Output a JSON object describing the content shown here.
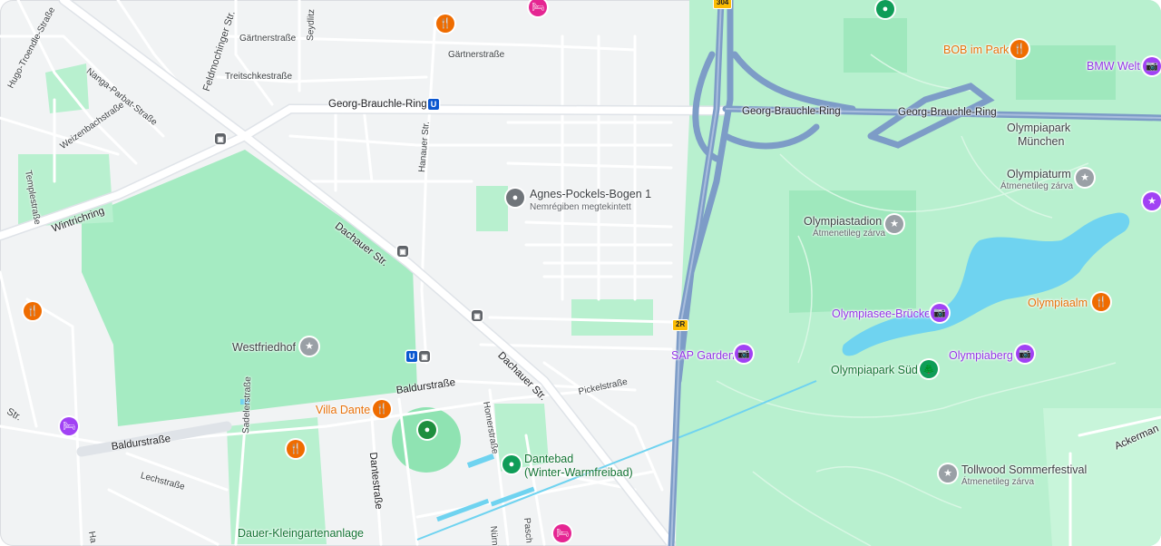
{
  "map": {
    "roads": {
      "georg_brauchle_ring_1": "Georg-Brauchle-Ring",
      "georg_brauchle_ring_2": "Georg-Brauchle-Ring",
      "georg_brauchle_ring_3": "Georg-Brauchle-Ring",
      "dachauer_str_1": "Dachauer Str.",
      "dachauer_str_2": "Dachauer Str.",
      "wintrichring": "Wintrichring",
      "baldurstrasse_1": "Baldurstraße",
      "baldurstrasse_2": "Baldurstraße",
      "feldmochinger_str": "Feldmochinger Str.",
      "gaertnerstrasse_1": "Gärtnerstraße",
      "gaertnerstrasse_2": "Gärtnerstraße",
      "treitschkestrasse": "Treitschkestraße",
      "nanga_parbat_strasse": "Nanga-Parbat-Straße",
      "hugo_troendle_strasse": "Hugo-Troendle-Straße",
      "weizenbachstrasse": "Weizenbachstraße",
      "templestrasse": "Templestraße",
      "hanauer_str": "Hanauer Str.",
      "homerstrasse": "Homerstraße",
      "pickelstrasse": "Pickelstraße",
      "dantestrasse": "Dantestraße",
      "sadelerstrasse": "Sadelerstraße",
      "lechstrasse": "Lechstraße",
      "ackermann": "Ackerman",
      "seydlitz": "Seydlitz",
      "str": "Str.",
      "nuernb": "Nürnb",
      "pasch": "Pasch",
      "ha": "Ha"
    },
    "shields": {
      "a2r": "2R",
      "top": "304"
    },
    "pois": {
      "agnes_pockels_title": "Agnes-Pockels-Bogen 1",
      "agnes_pockels_sub": "Nemrégiben megtekintett",
      "westfriedhof": "Westfriedhof",
      "villa_dante": "Villa Dante",
      "dantebad_1": "Dantebad",
      "dantebad_2": "(Winter-Warmfreibad)",
      "dauer_kleingarten": "Dauer-Kleingartenanlage",
      "bob_im_park": "BOB im Park",
      "bmw_welt": "BMW Welt",
      "olympiapark_1": "Olympiapark",
      "olympiapark_2": "München",
      "olympiaturm": "Olympiaturm",
      "olympiaturm_sub": "Átmenetileg zárva",
      "olympiastadion": "Olympiastadion",
      "olympiastadion_sub": "Átmenetileg zárva",
      "olympiasee_bruecke": "Olympiasee-Brücke",
      "olympiaalm": "Olympiaalm",
      "sap_garden": "SAP Garden",
      "olympiaberg": "Olympiaberg",
      "olympiapark_sued": "Olympiapark Süd",
      "tollwood": "Tollwood Sommerfestival",
      "tollwood_sub": "Átmenetileg zárva"
    },
    "icons": {
      "restaurant": "🍴",
      "camera": "📷",
      "tree": "🌲",
      "pool": "●",
      "location": "●",
      "transit": "🚉",
      "ubahn": "U",
      "stadium": "🏟",
      "tower": "🗼",
      "hotel": "🛏",
      "attraction": "★"
    },
    "colors": {
      "park": "#b9f2d0",
      "park_dark": "#8fe3b2",
      "water": "#6fd3f0",
      "highway": "#8aa4c8",
      "major_road": "#ffffff",
      "background": "#f1f3f4"
    }
  }
}
